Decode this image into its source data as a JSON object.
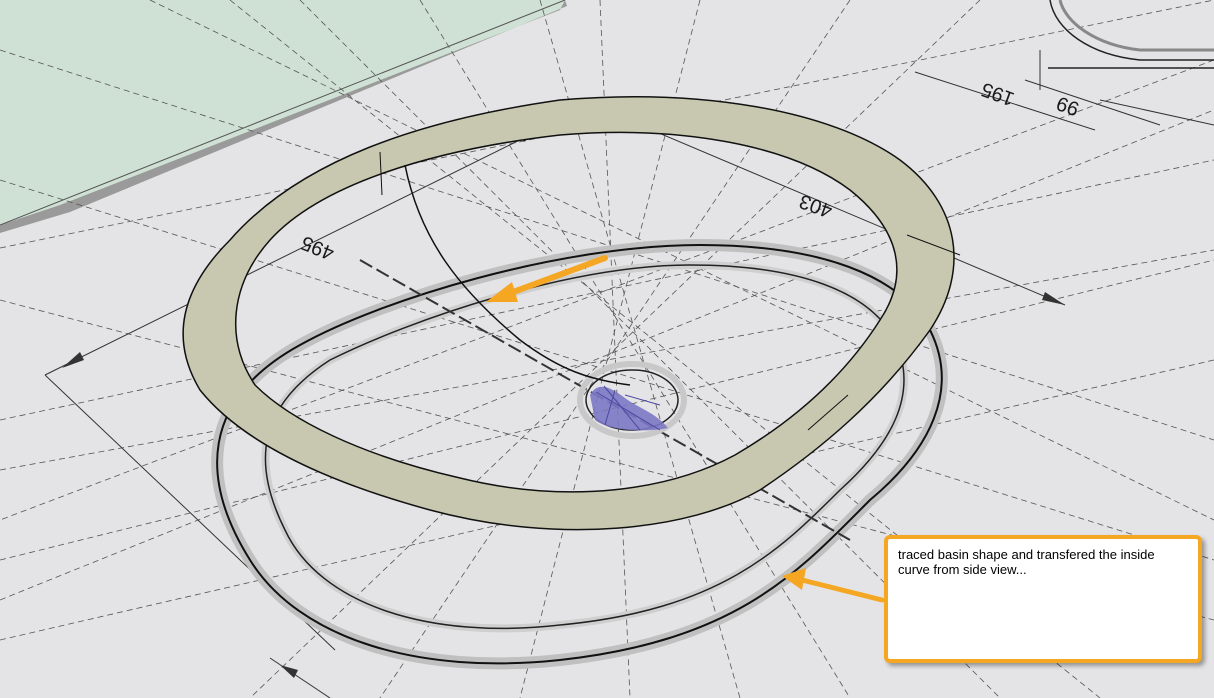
{
  "dimensions": {
    "d495": "495",
    "d403": "403",
    "d195": "195",
    "d99": "99"
  },
  "callout": {
    "text": "traced basin shape and transfered the inside curve from side view..."
  },
  "colors": {
    "background": "#e4e4e6",
    "ground_plane": "#cfe1d4",
    "rim": "#c8c8b1",
    "arrow": "#f5a623",
    "drain": "#7b78c4"
  }
}
